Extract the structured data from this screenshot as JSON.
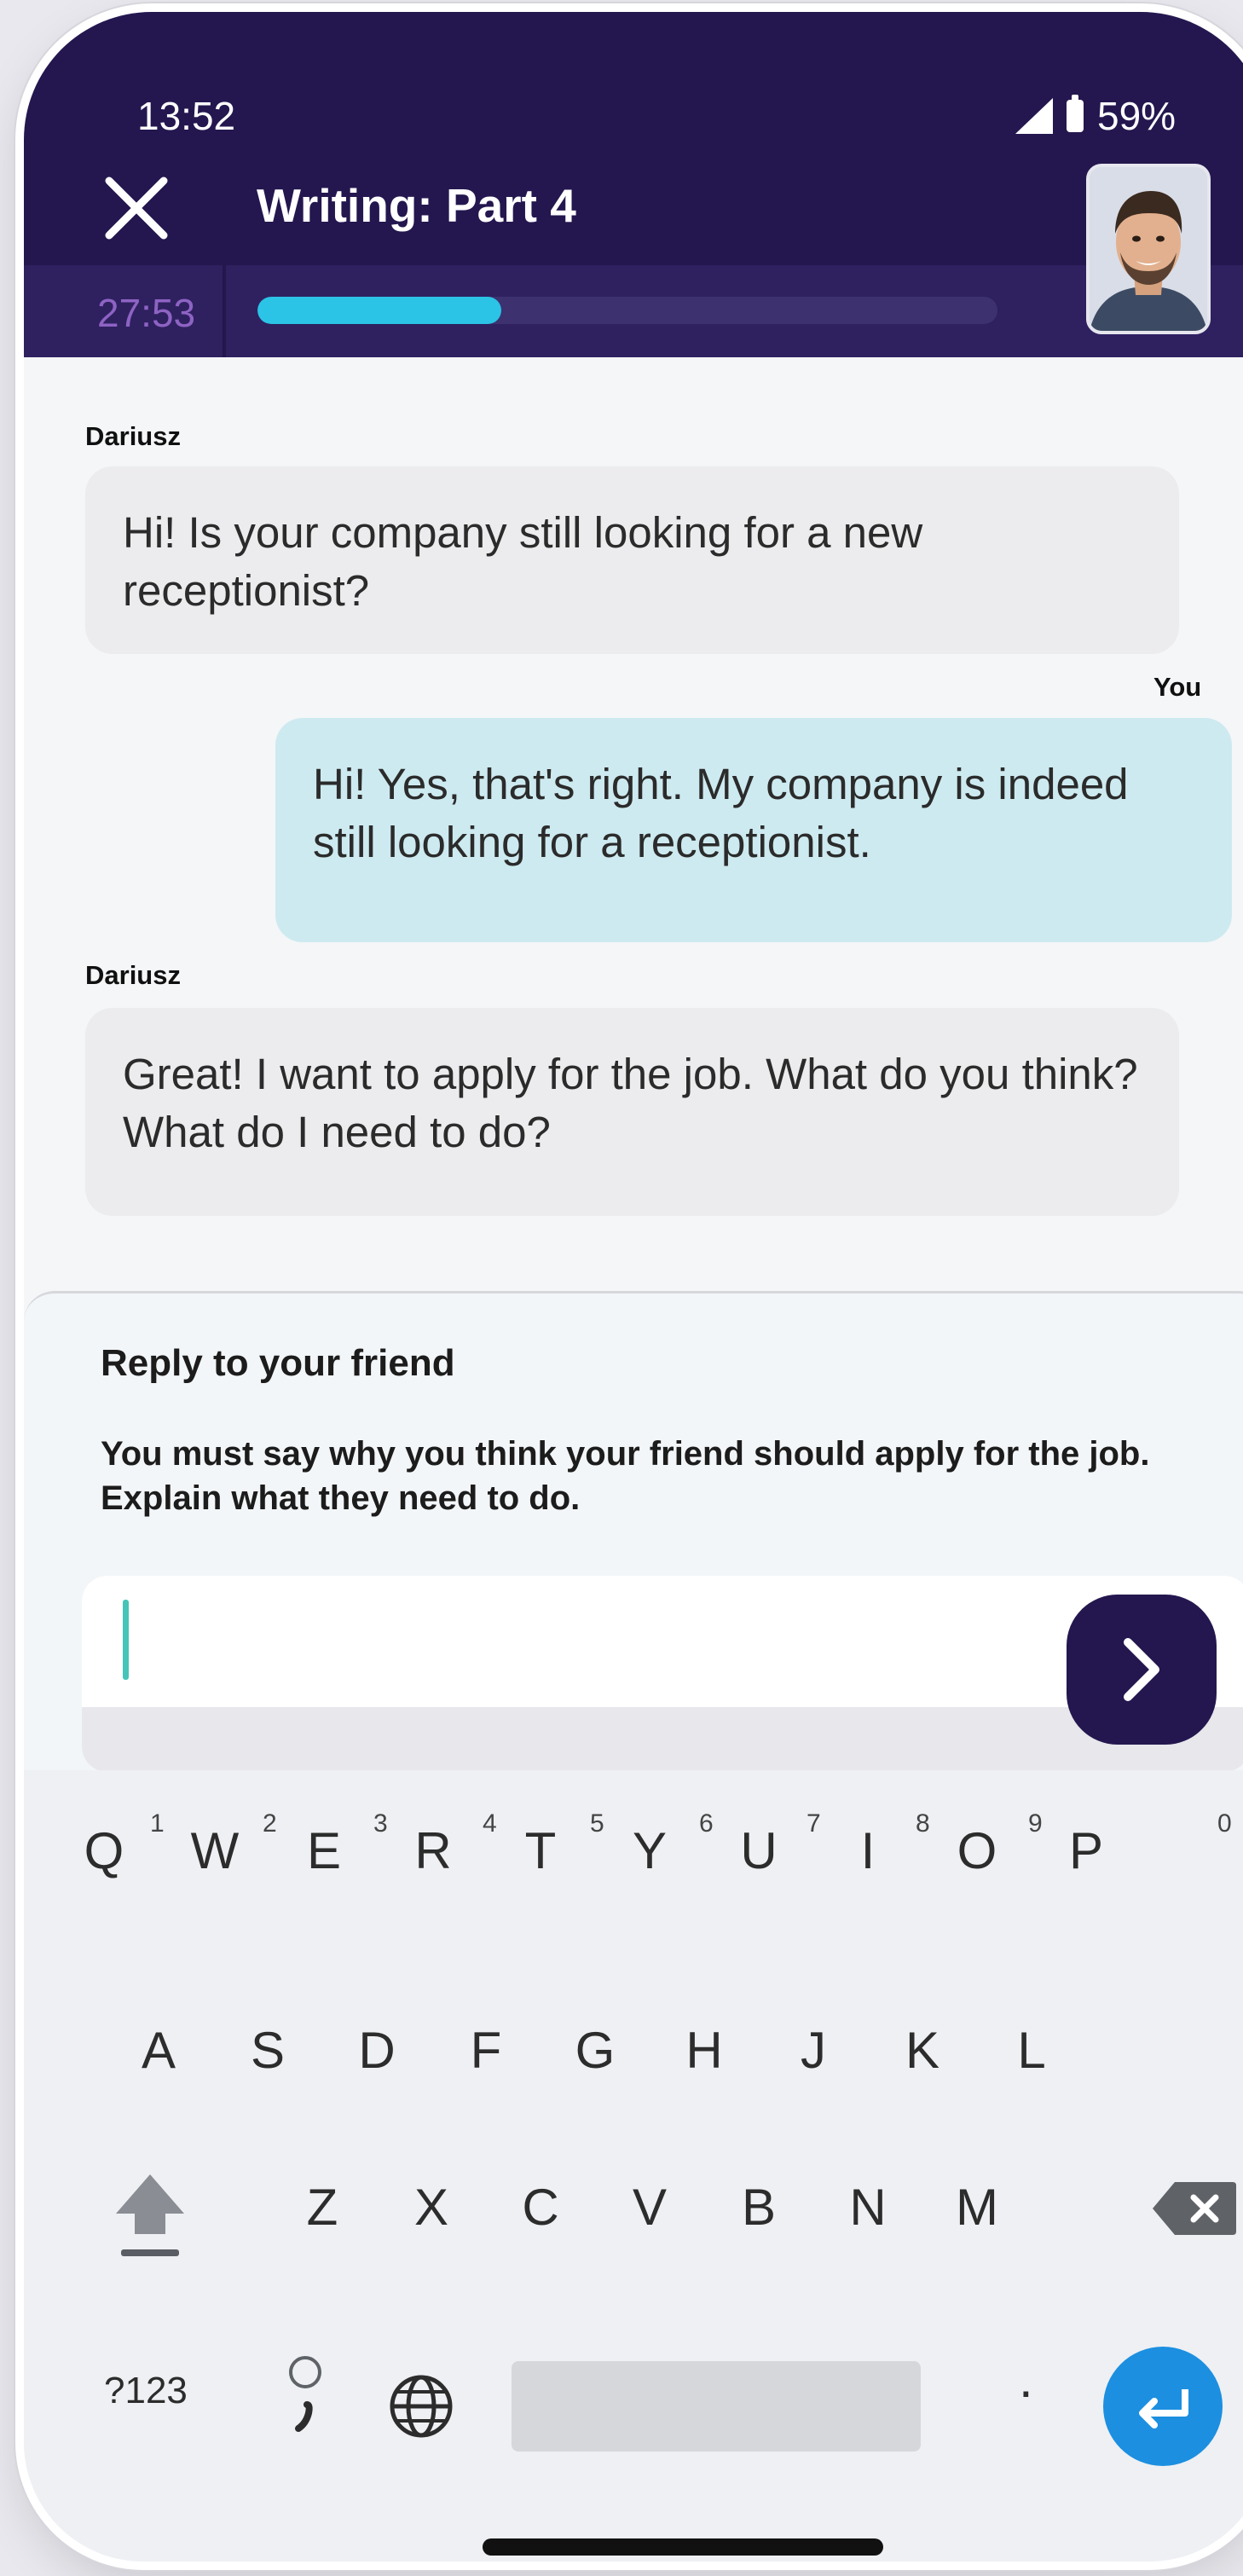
{
  "status_bar": {
    "time": "13:52",
    "battery": "59%"
  },
  "header": {
    "title": "Writing: Part 4",
    "timer": "27:53",
    "progress_fraction": 0.33
  },
  "chat": [
    {
      "sender": "Dariusz",
      "text": "Hi! Is your company still looking for a new receptionist?",
      "direction": "in"
    },
    {
      "sender": "You",
      "text": "Hi! Yes, that's right. My company is indeed still looking for a receptionist.",
      "direction": "out"
    },
    {
      "sender": "Dariusz",
      "text": "Great! I want to apply for the job. What do you think? What do I need to do?",
      "direction": "in"
    }
  ],
  "reply": {
    "title": "Reply to your friend",
    "instructions": "You must say why you think your friend should apply for the job. Explain what they need to do.",
    "input_value": ""
  },
  "keyboard": {
    "row1": [
      "Q",
      "W",
      "E",
      "R",
      "T",
      "Y",
      "U",
      "I",
      "O",
      "P"
    ],
    "row1_hints": [
      "1",
      "2",
      "3",
      "4",
      "5",
      "6",
      "7",
      "8",
      "9",
      "0"
    ],
    "row2": [
      "A",
      "S",
      "D",
      "F",
      "G",
      "H",
      "J",
      "K",
      "L"
    ],
    "row3": [
      "Z",
      "X",
      "C",
      "V",
      "B",
      "N",
      "M"
    ],
    "symbols_label": "?123",
    "period": "."
  },
  "colors": {
    "header": "#24174f",
    "accent": "#2bc3e6",
    "enter": "#1c8fe0"
  }
}
